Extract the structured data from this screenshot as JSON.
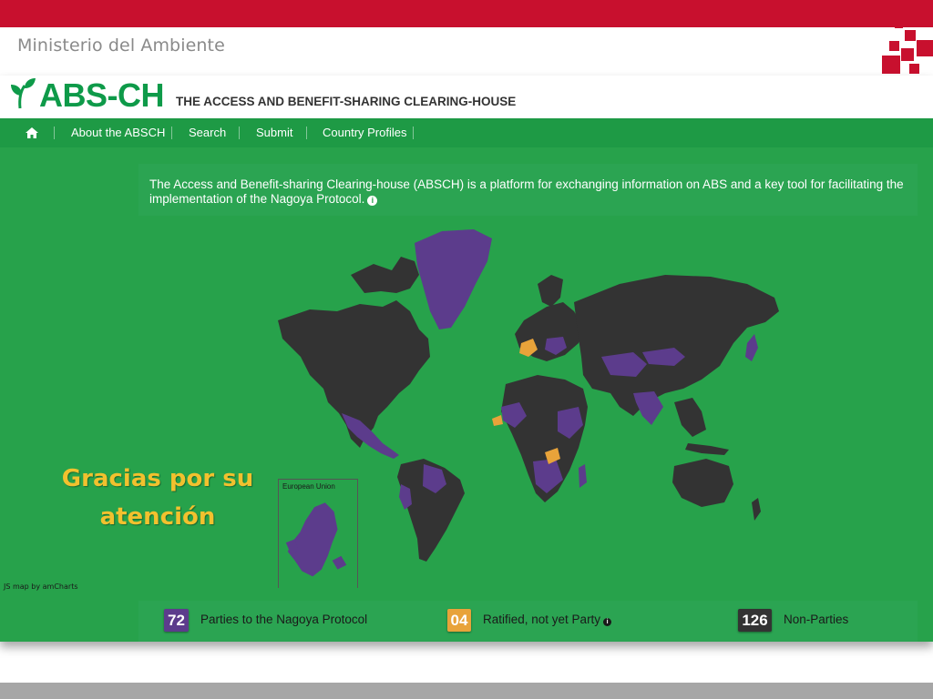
{
  "slide": {
    "ministry": "Ministerio del Ambiente",
    "thanks_line1": "Gracias por su",
    "thanks_line2": "atención"
  },
  "header": {
    "brand": "ABS-CH",
    "tagline": "THE ACCESS AND BENEFIT-SHARING CLEARING-HOUSE"
  },
  "nav": {
    "home_icon": "home-icon",
    "items": [
      "About the ABSCH",
      "Search",
      "Submit",
      "Country Profiles"
    ]
  },
  "intro": {
    "text": "The Access and Benefit-sharing Clearing-house (ABSCH) is a platform for exchanging information on ABS and a key tool for facilitating the implementation of the Nagoya Protocol.",
    "icon": "info-icon"
  },
  "map": {
    "inset_label": "European Union",
    "credit": "JS map by amCharts"
  },
  "legend": {
    "parties": {
      "count": "72",
      "label": "Parties to the Nagoya Protocol",
      "color": "#5c3c8c"
    },
    "ratified": {
      "count": "04",
      "label": "Ratified, not yet Party",
      "color": "#e8a33a"
    },
    "non_parties": {
      "count": "126",
      "label": "Non-Parties",
      "color": "#333333"
    }
  },
  "colors": {
    "accent_red": "#c8102e",
    "brand_green": "#0e9a49",
    "map_background": "#27a24b",
    "land_default": "#333333",
    "thanks_text": "#f2c12e"
  }
}
